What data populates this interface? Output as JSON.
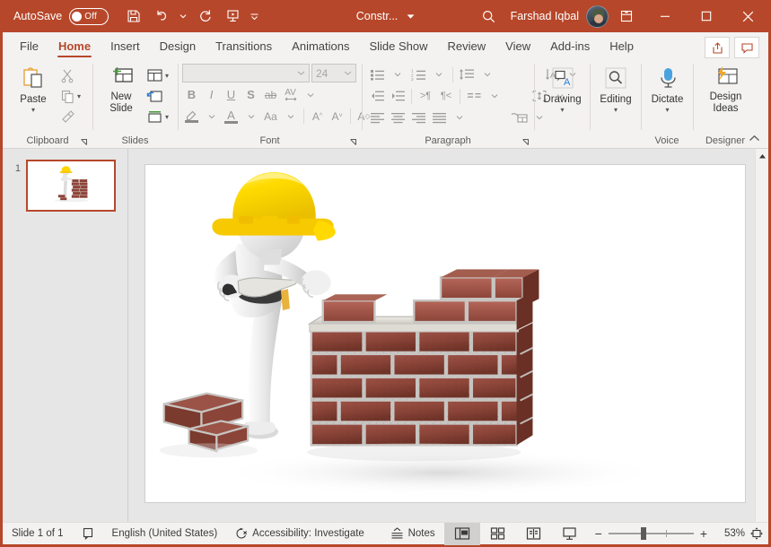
{
  "titlebar": {
    "autosave_label": "AutoSave",
    "autosave_state": "Off",
    "document_title": "Constr...",
    "username": "Farshad Iqbal",
    "quick_access": [
      "save-icon",
      "undo-icon",
      "redo-icon",
      "start-presentation-icon",
      "customize-qat-icon"
    ],
    "window_buttons": [
      "minimize",
      "maximize",
      "close"
    ],
    "search_icon": "search-icon",
    "ribbon_display_icon": "ribbon-display-options-icon",
    "accent_color": "#b7472a"
  },
  "tabs": [
    {
      "label": "File",
      "active": false
    },
    {
      "label": "Home",
      "active": true
    },
    {
      "label": "Insert",
      "active": false
    },
    {
      "label": "Design",
      "active": false
    },
    {
      "label": "Transitions",
      "active": false
    },
    {
      "label": "Animations",
      "active": false
    },
    {
      "label": "Slide Show",
      "active": false
    },
    {
      "label": "Review",
      "active": false
    },
    {
      "label": "View",
      "active": false
    },
    {
      "label": "Add-ins",
      "active": false
    },
    {
      "label": "Help",
      "active": false
    }
  ],
  "tabstrip_buttons": [
    {
      "name": "share-button",
      "icon": "share-icon"
    },
    {
      "name": "comments-button",
      "icon": "comment-icon"
    }
  ],
  "ribbon": {
    "collapse_icon": "chevron-up-icon",
    "groups": [
      {
        "name": "clipboard",
        "label": "Clipboard",
        "has_launcher": true,
        "buttons": [
          {
            "name": "paste-button",
            "label": "Paste",
            "icon": "paste-icon",
            "dropdown": true
          },
          {
            "name": "cut-button",
            "label": "",
            "icon": "scissors-icon",
            "dropdown": false
          },
          {
            "name": "copy-button",
            "label": "",
            "icon": "copy-icon",
            "dropdown": true
          },
          {
            "name": "format-painter-button",
            "label": "",
            "icon": "format-painter-icon",
            "dropdown": false
          }
        ]
      },
      {
        "name": "slides",
        "label": "Slides",
        "has_launcher": false,
        "buttons": [
          {
            "name": "new-slide-button",
            "label": "New Slide",
            "icon": "new-slide-icon",
            "dropdown": true
          },
          {
            "name": "layout-button",
            "label": "",
            "icon": "layout-icon",
            "dropdown": true
          },
          {
            "name": "reset-button",
            "label": "",
            "icon": "reset-slide-icon",
            "dropdown": false
          },
          {
            "name": "section-button",
            "label": "",
            "icon": "section-icon",
            "dropdown": true
          }
        ]
      },
      {
        "name": "font",
        "label": "Font",
        "has_launcher": true,
        "font_name_value": "",
        "font_size_value": "24",
        "buttons": [
          {
            "name": "bold-button",
            "glyph": "B"
          },
          {
            "name": "italic-button",
            "glyph": "I"
          },
          {
            "name": "underline-button",
            "glyph": "U"
          },
          {
            "name": "text-shadow-button",
            "glyph": "S"
          },
          {
            "name": "strikethrough-button",
            "glyph": "ab"
          },
          {
            "name": "character-spacing-button",
            "glyph": "AV"
          },
          {
            "name": "text-highlight-color-button",
            "glyph": "highlight-icon"
          },
          {
            "name": "font-color-button",
            "glyph": "font-color-icon"
          },
          {
            "name": "change-case-button",
            "glyph": "Aa"
          },
          {
            "name": "increase-font-size-button",
            "glyph": "A^"
          },
          {
            "name": "decrease-font-size-button",
            "glyph": "Av"
          },
          {
            "name": "clear-formatting-button",
            "glyph": "clear-format-icon"
          }
        ]
      },
      {
        "name": "paragraph",
        "label": "Paragraph",
        "has_launcher": true,
        "buttons": [
          {
            "name": "bullets-button",
            "icon": "bullets-icon"
          },
          {
            "name": "numbering-button",
            "icon": "numbering-icon"
          },
          {
            "name": "line-spacing-button",
            "icon": "line-spacing-icon"
          },
          {
            "name": "text-direction-button",
            "icon": "text-direction-icon"
          },
          {
            "name": "decrease-indent-button",
            "icon": "decrease-indent-icon"
          },
          {
            "name": "increase-indent-button",
            "icon": "increase-indent-icon"
          },
          {
            "name": "ltr-button",
            "icon": "ltr-icon"
          },
          {
            "name": "rtl-button",
            "icon": "rtl-icon"
          },
          {
            "name": "columns-button",
            "icon": "columns-icon"
          },
          {
            "name": "align-text-button",
            "icon": "align-text-vertical-icon"
          },
          {
            "name": "align-left-button",
            "icon": "align-left-icon"
          },
          {
            "name": "align-center-button",
            "icon": "align-center-icon"
          },
          {
            "name": "align-right-button",
            "icon": "align-right-icon"
          },
          {
            "name": "justify-button",
            "icon": "justify-icon"
          },
          {
            "name": "convert-smartart-button",
            "icon": "smartart-icon"
          }
        ]
      },
      {
        "name": "drawing",
        "label": "",
        "has_launcher": false,
        "buttons": [
          {
            "name": "drawing-button",
            "label": "Drawing",
            "icon": "drawing-shapes-icon",
            "dropdown": true
          }
        ]
      },
      {
        "name": "editing",
        "label": "",
        "has_launcher": false,
        "buttons": [
          {
            "name": "editing-button",
            "label": "Editing",
            "icon": "magnifier-icon",
            "dropdown": true
          }
        ]
      },
      {
        "name": "voice",
        "label": "Voice",
        "has_launcher": false,
        "buttons": [
          {
            "name": "dictate-button",
            "label": "Dictate",
            "icon": "microphone-icon",
            "dropdown": true
          }
        ]
      },
      {
        "name": "designer",
        "label": "Designer",
        "has_launcher": false,
        "buttons": [
          {
            "name": "design-ideas-button",
            "label": "Design Ideas",
            "icon": "design-ideas-icon",
            "dropdown": false
          }
        ]
      }
    ]
  },
  "thumbnails": {
    "slides": [
      {
        "number": "1",
        "selected": true
      }
    ]
  },
  "slide": {
    "background": "#ffffff",
    "artwork": {
      "name": "bricklayer-3d-figure",
      "description": "3D white figure with yellow hard hat building a red brick wall",
      "helmet_color": "#ffd400",
      "brick_color": "#8e4438",
      "figure_color": "#e9e9e9"
    }
  },
  "statusbar": {
    "slide_count": "Slide 1 of 1",
    "notes_icon": "notes-page-icon",
    "language": "English (United States)",
    "accessibility": "Accessibility: Investigate",
    "accessibility_icon": "accessibility-icon",
    "notes_label": "Notes",
    "views": [
      {
        "name": "normal-view-button",
        "icon": "normal-view-icon",
        "active": true
      },
      {
        "name": "slide-sorter-button",
        "icon": "slide-sorter-icon",
        "active": false
      },
      {
        "name": "reading-view-button",
        "icon": "reading-view-icon",
        "active": false
      },
      {
        "name": "slide-show-button",
        "icon": "slide-show-icon",
        "active": false
      }
    ],
    "zoom_out_label": "−",
    "zoom_in_label": "+",
    "zoom_percent": "53%",
    "fit_icon": "fit-slide-to-window-icon"
  }
}
